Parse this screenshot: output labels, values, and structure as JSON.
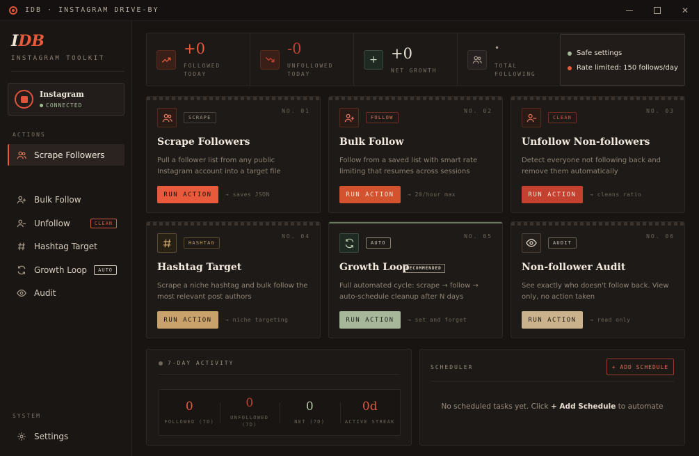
{
  "window": {
    "title": "IDB · INSTAGRAM DRIVE-BY",
    "minimize": "—",
    "close": "✕"
  },
  "sidebar": {
    "logo_a": "I",
    "logo_b": "DB",
    "subtitle": "INSTAGRAM TOOLKIT",
    "account": {
      "name": "Instagram",
      "status": "CONNECTED"
    },
    "actions_label": "ACTIONS",
    "items": [
      {
        "label": "Scrape Followers",
        "icon": "users-icon",
        "active": true
      },
      {
        "label": "Bulk Follow",
        "icon": "user-plus-icon"
      },
      {
        "label": "Unfollow",
        "icon": "user-minus-icon",
        "tag": "CLEAN"
      },
      {
        "label": "Hashtag Target",
        "icon": "hash-icon"
      },
      {
        "label": "Growth Loop",
        "icon": "refresh-icon",
        "tag": "AUTO"
      },
      {
        "label": "Audit",
        "icon": "eye-icon"
      }
    ],
    "system_label": "SYSTEM",
    "settings_label": "Settings"
  },
  "stats": {
    "followed": {
      "value": "+0",
      "label_1": "FOLLOWED",
      "label_2": "TODAY"
    },
    "unfollowed": {
      "value": "-0",
      "label_1": "UNFOLLOWED",
      "label_2": "TODAY"
    },
    "net": {
      "value": "+0",
      "label_1": "NET GROWTH",
      "icon": "+"
    },
    "total": {
      "value": "•",
      "label_1": "TOTAL",
      "label_2": "FOLLOWING"
    },
    "notes": [
      "Safe settings",
      "Rate limited: 150 follows/day"
    ]
  },
  "cards": [
    {
      "tag": "SCRAPE",
      "no": "NO. 01",
      "title": "Scrape Followers",
      "desc": "Pull a follower list from any public Instagram account into a target file",
      "button": "RUN ACTION",
      "hint": "→ saves JSON"
    },
    {
      "tag": "FOLLOW",
      "no": "NO. 02",
      "title": "Bulk Follow",
      "desc": "Follow from a saved list with smart rate limiting that resumes across sessions",
      "button": "RUN ACTION",
      "hint": "→ 20/hour max"
    },
    {
      "tag": "CLEAN",
      "no": "NO. 03",
      "title": "Unfollow Non-followers",
      "desc": "Detect everyone not following back and remove them automatically",
      "button": "RUN ACTION",
      "hint": "→ cleans ratio"
    },
    {
      "tag": "HASHTAG",
      "no": "NO. 04",
      "title": "Hashtag Target",
      "desc": "Scrape a niche hashtag and bulk follow the most relevant post authors",
      "button": "RUN ACTION",
      "hint": "→ niche targeting"
    },
    {
      "tag": "AUTO",
      "no": "NO. 05",
      "title": "Growth Loop",
      "badge": "RECOMMENDED",
      "desc": "Full automated cycle: scrape → follow → auto-schedule cleanup after N days",
      "button": "RUN ACTION",
      "hint": "→ set and forget"
    },
    {
      "tag": "AUDIT",
      "no": "NO. 06",
      "title": "Non-follower Audit",
      "desc": "See exactly who doesn't follow back. View only, no action taken",
      "button": "RUN ACTION",
      "hint": "→ read only"
    }
  ],
  "activity": {
    "title": "7-DAY ACTIVITY",
    "items": [
      {
        "value": "0",
        "label": "FOLLOWED (7D)"
      },
      {
        "value": "0",
        "label": "UNFOLLOWED",
        "label_2": "(7D)"
      },
      {
        "value": "0",
        "label": "NET (7D)"
      },
      {
        "value": "0d",
        "label": "ACTIVE STREAK"
      }
    ]
  },
  "scheduler": {
    "title": "SCHEDULER",
    "add_button": "+ ADD SCHEDULE",
    "empty_pre": "No scheduled tasks yet. Click",
    "empty_link": "+ Add Schedule",
    "empty_post": "to automate"
  },
  "colors": {
    "accent": "#e85a3c",
    "follow_btn": "#d4532f",
    "unfollow_btn": "#c4402f",
    "tan_btn": "#c9a26b",
    "green_btn": "#a7b89a"
  }
}
